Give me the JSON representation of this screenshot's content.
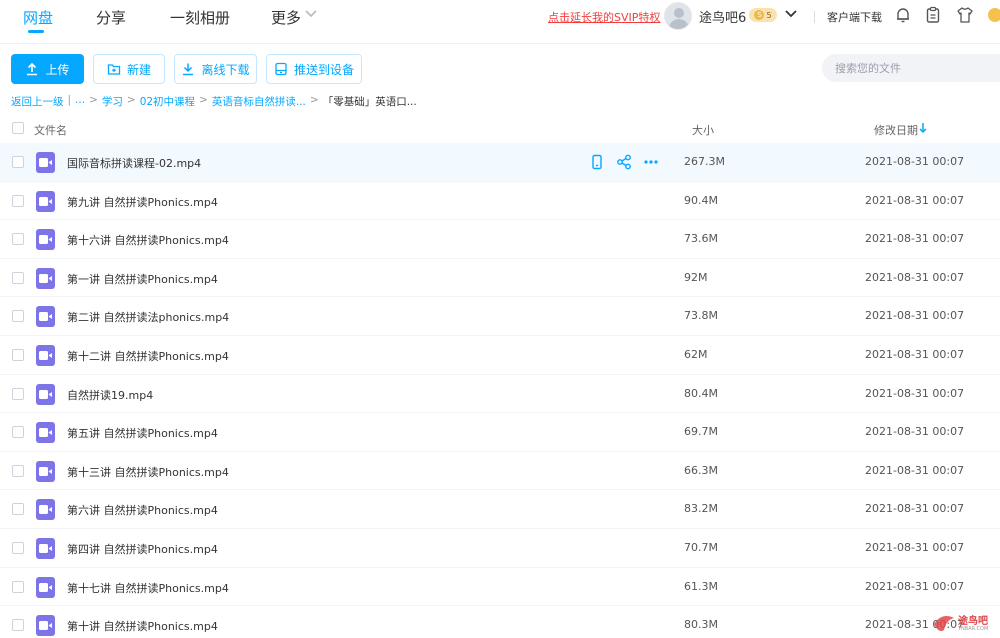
{
  "nav": {
    "tabs": [
      {
        "label": "网盘"
      },
      {
        "label": "分享"
      },
      {
        "label": "一刻相册"
      },
      {
        "label": "更多"
      }
    ],
    "promo": "点击延长我的SVIP特权",
    "username": "途鸟吧6",
    "vip_badge": "5",
    "client_download": "客户端下载",
    "accent_color": "#06a7ff"
  },
  "toolbar": {
    "upload": "上传",
    "new": "新建",
    "offline_download": "离线下载",
    "push_to_device": "推送到设备",
    "search_placeholder": "搜索您的文件"
  },
  "breadcrumb": {
    "back": "返回上一级",
    "ellipsis": "...",
    "items": [
      "学习",
      "02初中课程",
      "英语音标自然拼读...",
      "「零基础」英语口..."
    ]
  },
  "table": {
    "col_name": "文件名",
    "col_size": "大小",
    "col_date": "修改日期",
    "rows": [
      {
        "name": "国际音标拼读课程-02.mp4",
        "size": "267.3M",
        "date": "2021-08-31 00:07"
      },
      {
        "name": "第九讲 自然拼读Phonics.mp4",
        "size": "90.4M",
        "date": "2021-08-31 00:07"
      },
      {
        "name": "第十六讲 自然拼读Phonics.mp4",
        "size": "73.6M",
        "date": "2021-08-31 00:07"
      },
      {
        "name": "第一讲 自然拼读Phonics.mp4",
        "size": "92M",
        "date": "2021-08-31 00:07"
      },
      {
        "name": "第二讲 自然拼读法phonics.mp4",
        "size": "73.8M",
        "date": "2021-08-31 00:07"
      },
      {
        "name": "第十二讲 自然拼读Phonics.mp4",
        "size": "62M",
        "date": "2021-08-31 00:07"
      },
      {
        "name": "自然拼读19.mp4",
        "size": "80.4M",
        "date": "2021-08-31 00:07"
      },
      {
        "name": "第五讲 自然拼读Phonics.mp4",
        "size": "69.7M",
        "date": "2021-08-31 00:07"
      },
      {
        "name": "第十三讲 自然拼读Phonics.mp4",
        "size": "66.3M",
        "date": "2021-08-31 00:07"
      },
      {
        "name": "第六讲 自然拼读Phonics.mp4",
        "size": "83.2M",
        "date": "2021-08-31 00:07"
      },
      {
        "name": "第四讲 自然拼读Phonics.mp4",
        "size": "70.7M",
        "date": "2021-08-31 00:07"
      },
      {
        "name": "第十七讲 自然拼读Phonics.mp4",
        "size": "61.3M",
        "date": "2021-08-31 00:07"
      },
      {
        "name": "第十讲 自然拼读Phonics.mp4",
        "size": "80.3M",
        "date": "2021-08-31 00:07"
      }
    ]
  },
  "watermark": {
    "text": "途鸟吧",
    "sub": "TNBAR.COM"
  }
}
